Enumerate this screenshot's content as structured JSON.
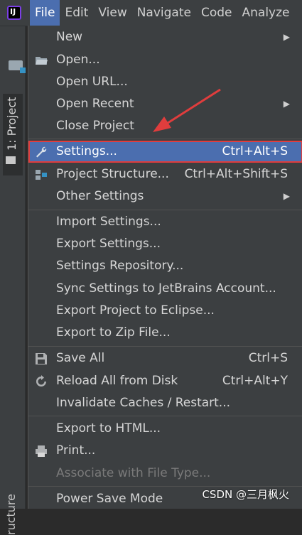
{
  "menubar": {
    "items": [
      "File",
      "Edit",
      "View",
      "Navigate",
      "Code",
      "Analyze"
    ],
    "active": "File"
  },
  "left_strip": {
    "project_tab": "1: Project",
    "structure_tab": "ructure"
  },
  "file_menu": {
    "items": [
      {
        "label": "New",
        "shortcut": "",
        "submenu": true
      },
      {
        "label": "Open...",
        "shortcut": "",
        "submenu": false
      },
      {
        "label": "Open URL...",
        "shortcut": "",
        "submenu": false
      },
      {
        "label": "Open Recent",
        "shortcut": "",
        "submenu": true
      },
      {
        "label": "Close Project",
        "shortcut": "",
        "submenu": false
      },
      {
        "label": "Settings...",
        "shortcut": "Ctrl+Alt+S",
        "submenu": false,
        "selected": true
      },
      {
        "label": "Project Structure...",
        "shortcut": "Ctrl+Alt+Shift+S",
        "submenu": false
      },
      {
        "label": "Other Settings",
        "shortcut": "",
        "submenu": true
      },
      {
        "label": "Import Settings...",
        "shortcut": "",
        "submenu": false
      },
      {
        "label": "Export Settings...",
        "shortcut": "",
        "submenu": false
      },
      {
        "label": "Settings Repository...",
        "shortcut": "",
        "submenu": false
      },
      {
        "label": "Sync Settings to JetBrains Account...",
        "shortcut": "",
        "submenu": false
      },
      {
        "label": "Export Project to Eclipse...",
        "shortcut": "",
        "submenu": false
      },
      {
        "label": "Export to Zip File...",
        "shortcut": "",
        "submenu": false
      },
      {
        "label": "Save All",
        "shortcut": "Ctrl+S",
        "submenu": false
      },
      {
        "label": "Reload All from Disk",
        "shortcut": "Ctrl+Alt+Y",
        "submenu": false
      },
      {
        "label": "Invalidate Caches / Restart...",
        "shortcut": "",
        "submenu": false
      },
      {
        "label": "Export to HTML...",
        "shortcut": "",
        "submenu": false
      },
      {
        "label": "Print...",
        "shortcut": "",
        "submenu": false
      },
      {
        "label": "Associate with File Type...",
        "shortcut": "",
        "submenu": false,
        "disabled": true
      },
      {
        "label": "Power Save Mode",
        "shortcut": "",
        "submenu": false
      }
    ]
  },
  "watermark": "CSDN @三月枫火",
  "colors": {
    "menubar_bg": "#3c3f41",
    "selection": "#4b6eaf",
    "highlight_border": "#e03d3d",
    "arrow": "#e03d3d"
  }
}
